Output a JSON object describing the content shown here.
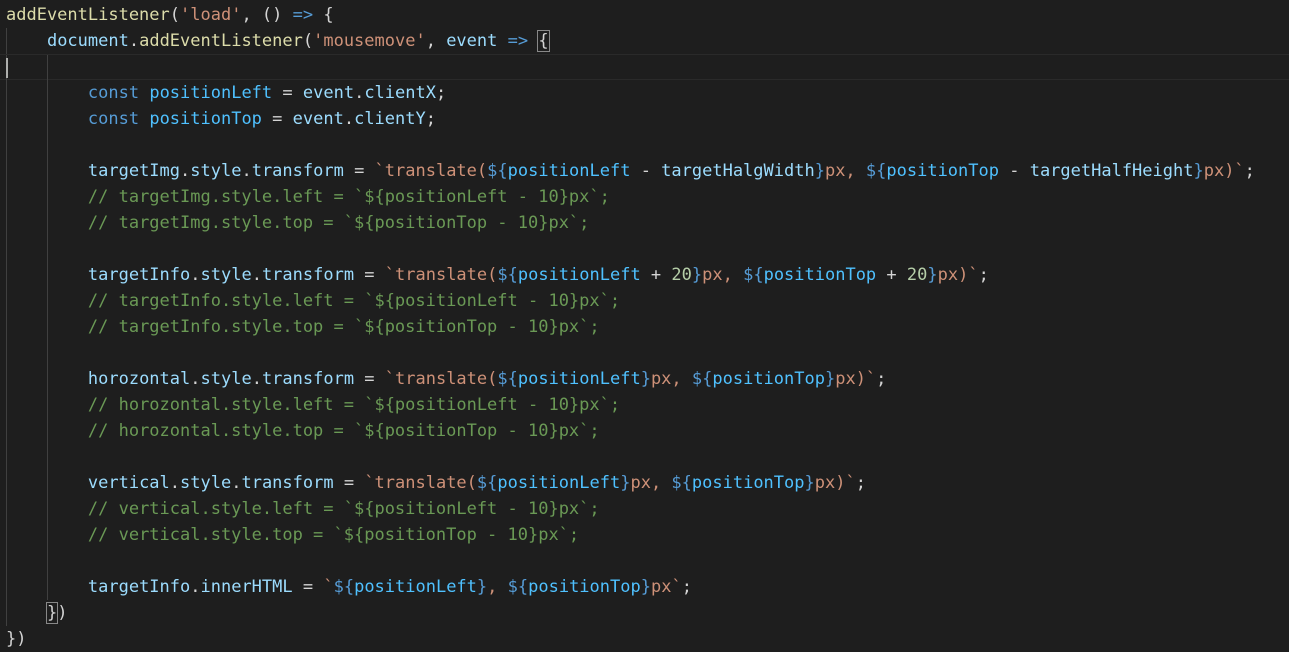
{
  "editor": {
    "lines": [
      {
        "tokens": [
          {
            "t": "fn",
            "v": "addEventListener"
          },
          {
            "t": "pun",
            "v": "("
          },
          {
            "t": "str",
            "v": "'load'"
          },
          {
            "t": "pun",
            "v": ", () "
          },
          {
            "t": "kw",
            "v": "=>"
          },
          {
            "t": "pun",
            "v": " {"
          }
        ]
      },
      {
        "tokens": [
          {
            "t": "pun",
            "v": "    "
          },
          {
            "t": "var",
            "v": "document"
          },
          {
            "t": "pun",
            "v": "."
          },
          {
            "t": "fn",
            "v": "addEventListener"
          },
          {
            "t": "pun",
            "v": "("
          },
          {
            "t": "str",
            "v": "'mousemove'"
          },
          {
            "t": "pun",
            "v": ", "
          },
          {
            "t": "var",
            "v": "event"
          },
          {
            "t": "pun",
            "v": " "
          },
          {
            "t": "kw",
            "v": "=>"
          },
          {
            "t": "pun",
            "v": " "
          },
          {
            "t": "brace",
            "v": "{"
          }
        ]
      },
      {
        "tokens": []
      },
      {
        "tokens": [
          {
            "t": "pun",
            "v": "        "
          },
          {
            "t": "kw",
            "v": "const"
          },
          {
            "t": "pun",
            "v": " "
          },
          {
            "t": "const",
            "v": "positionLeft"
          },
          {
            "t": "pun",
            "v": " = "
          },
          {
            "t": "var",
            "v": "event"
          },
          {
            "t": "pun",
            "v": "."
          },
          {
            "t": "var",
            "v": "clientX"
          },
          {
            "t": "pun",
            "v": ";"
          }
        ]
      },
      {
        "tokens": [
          {
            "t": "pun",
            "v": "        "
          },
          {
            "t": "kw",
            "v": "const"
          },
          {
            "t": "pun",
            "v": " "
          },
          {
            "t": "const",
            "v": "positionTop"
          },
          {
            "t": "pun",
            "v": " = "
          },
          {
            "t": "var",
            "v": "event"
          },
          {
            "t": "pun",
            "v": "."
          },
          {
            "t": "var",
            "v": "clientY"
          },
          {
            "t": "pun",
            "v": ";"
          }
        ]
      },
      {
        "tokens": []
      },
      {
        "tokens": [
          {
            "t": "pun",
            "v": "        "
          },
          {
            "t": "var",
            "v": "targetImg"
          },
          {
            "t": "pun",
            "v": "."
          },
          {
            "t": "var",
            "v": "style"
          },
          {
            "t": "pun",
            "v": "."
          },
          {
            "t": "var",
            "v": "transform"
          },
          {
            "t": "pun",
            "v": " = "
          },
          {
            "t": "str",
            "v": "`translate("
          },
          {
            "t": "kw",
            "v": "${"
          },
          {
            "t": "const",
            "v": "positionLeft"
          },
          {
            "t": "pun",
            "v": " - "
          },
          {
            "t": "var",
            "v": "targetHalgWidth"
          },
          {
            "t": "kw",
            "v": "}"
          },
          {
            "t": "str",
            "v": "px, "
          },
          {
            "t": "kw",
            "v": "${"
          },
          {
            "t": "const",
            "v": "positionTop"
          },
          {
            "t": "pun",
            "v": " - "
          },
          {
            "t": "var",
            "v": "targetHalfHeight"
          },
          {
            "t": "kw",
            "v": "}"
          },
          {
            "t": "str",
            "v": "px)`"
          },
          {
            "t": "pun",
            "v": ";"
          }
        ]
      },
      {
        "tokens": [
          {
            "t": "pun",
            "v": "        "
          },
          {
            "t": "cmt",
            "v": "// targetImg.style.left = `${positionLeft - 10}px`;"
          }
        ]
      },
      {
        "tokens": [
          {
            "t": "pun",
            "v": "        "
          },
          {
            "t": "cmt",
            "v": "// targetImg.style.top = `${positionTop - 10}px`;"
          }
        ]
      },
      {
        "tokens": []
      },
      {
        "tokens": [
          {
            "t": "pun",
            "v": "        "
          },
          {
            "t": "var",
            "v": "targetInfo"
          },
          {
            "t": "pun",
            "v": "."
          },
          {
            "t": "var",
            "v": "style"
          },
          {
            "t": "pun",
            "v": "."
          },
          {
            "t": "var",
            "v": "transform"
          },
          {
            "t": "pun",
            "v": " = "
          },
          {
            "t": "str",
            "v": "`translate("
          },
          {
            "t": "kw",
            "v": "${"
          },
          {
            "t": "const",
            "v": "positionLeft"
          },
          {
            "t": "pun",
            "v": " + "
          },
          {
            "t": "num",
            "v": "20"
          },
          {
            "t": "kw",
            "v": "}"
          },
          {
            "t": "str",
            "v": "px, "
          },
          {
            "t": "kw",
            "v": "${"
          },
          {
            "t": "const",
            "v": "positionTop"
          },
          {
            "t": "pun",
            "v": " + "
          },
          {
            "t": "num",
            "v": "20"
          },
          {
            "t": "kw",
            "v": "}"
          },
          {
            "t": "str",
            "v": "px)`"
          },
          {
            "t": "pun",
            "v": ";"
          }
        ]
      },
      {
        "tokens": [
          {
            "t": "pun",
            "v": "        "
          },
          {
            "t": "cmt",
            "v": "// targetInfo.style.left = `${positionLeft - 10}px`;"
          }
        ]
      },
      {
        "tokens": [
          {
            "t": "pun",
            "v": "        "
          },
          {
            "t": "cmt",
            "v": "// targetInfo.style.top = `${positionTop - 10}px`;"
          }
        ]
      },
      {
        "tokens": []
      },
      {
        "tokens": [
          {
            "t": "pun",
            "v": "        "
          },
          {
            "t": "var",
            "v": "horozontal"
          },
          {
            "t": "pun",
            "v": "."
          },
          {
            "t": "var",
            "v": "style"
          },
          {
            "t": "pun",
            "v": "."
          },
          {
            "t": "var",
            "v": "transform"
          },
          {
            "t": "pun",
            "v": " = "
          },
          {
            "t": "str",
            "v": "`translate("
          },
          {
            "t": "kw",
            "v": "${"
          },
          {
            "t": "const",
            "v": "positionLeft"
          },
          {
            "t": "kw",
            "v": "}"
          },
          {
            "t": "str",
            "v": "px, "
          },
          {
            "t": "kw",
            "v": "${"
          },
          {
            "t": "const",
            "v": "positionTop"
          },
          {
            "t": "kw",
            "v": "}"
          },
          {
            "t": "str",
            "v": "px)`"
          },
          {
            "t": "pun",
            "v": ";"
          }
        ]
      },
      {
        "tokens": [
          {
            "t": "pun",
            "v": "        "
          },
          {
            "t": "cmt",
            "v": "// horozontal.style.left = `${positionLeft - 10}px`;"
          }
        ]
      },
      {
        "tokens": [
          {
            "t": "pun",
            "v": "        "
          },
          {
            "t": "cmt",
            "v": "// horozontal.style.top = `${positionTop - 10}px`;"
          }
        ]
      },
      {
        "tokens": []
      },
      {
        "tokens": [
          {
            "t": "pun",
            "v": "        "
          },
          {
            "t": "var",
            "v": "vertical"
          },
          {
            "t": "pun",
            "v": "."
          },
          {
            "t": "var",
            "v": "style"
          },
          {
            "t": "pun",
            "v": "."
          },
          {
            "t": "var",
            "v": "transform"
          },
          {
            "t": "pun",
            "v": " = "
          },
          {
            "t": "str",
            "v": "`translate("
          },
          {
            "t": "kw",
            "v": "${"
          },
          {
            "t": "const",
            "v": "positionLeft"
          },
          {
            "t": "kw",
            "v": "}"
          },
          {
            "t": "str",
            "v": "px, "
          },
          {
            "t": "kw",
            "v": "${"
          },
          {
            "t": "const",
            "v": "positionTop"
          },
          {
            "t": "kw",
            "v": "}"
          },
          {
            "t": "str",
            "v": "px)`"
          },
          {
            "t": "pun",
            "v": ";"
          }
        ]
      },
      {
        "tokens": [
          {
            "t": "pun",
            "v": "        "
          },
          {
            "t": "cmt",
            "v": "// vertical.style.left = `${positionLeft - 10}px`;"
          }
        ]
      },
      {
        "tokens": [
          {
            "t": "pun",
            "v": "        "
          },
          {
            "t": "cmt",
            "v": "// vertical.style.top = `${positionTop - 10}px`;"
          }
        ]
      },
      {
        "tokens": []
      },
      {
        "tokens": [
          {
            "t": "pun",
            "v": "        "
          },
          {
            "t": "var",
            "v": "targetInfo"
          },
          {
            "t": "pun",
            "v": "."
          },
          {
            "t": "var",
            "v": "innerHTML"
          },
          {
            "t": "pun",
            "v": " = "
          },
          {
            "t": "str",
            "v": "`"
          },
          {
            "t": "kw",
            "v": "${"
          },
          {
            "t": "const",
            "v": "positionLeft"
          },
          {
            "t": "kw",
            "v": "}"
          },
          {
            "t": "str",
            "v": ", "
          },
          {
            "t": "kw",
            "v": "${"
          },
          {
            "t": "const",
            "v": "positionTop"
          },
          {
            "t": "kw",
            "v": "}"
          },
          {
            "t": "str",
            "v": "px`"
          },
          {
            "t": "pun",
            "v": ";"
          }
        ]
      },
      {
        "tokens": [
          {
            "t": "pun",
            "v": "    "
          },
          {
            "t": "brace",
            "v": "}"
          },
          {
            "t": "pun",
            "v": ")"
          }
        ]
      },
      {
        "tokens": [
          {
            "t": "pun",
            "v": "})"
          }
        ]
      }
    ],
    "colors": {
      "background": "#1e1e1e",
      "function": "#dcdcaa",
      "string": "#ce9178",
      "keyword": "#569cd6",
      "variable": "#9cdcfe",
      "constant": "#4fc1ff",
      "number": "#b5cea8",
      "comment": "#6a9955",
      "punctuation": "#d4d4d4"
    }
  }
}
